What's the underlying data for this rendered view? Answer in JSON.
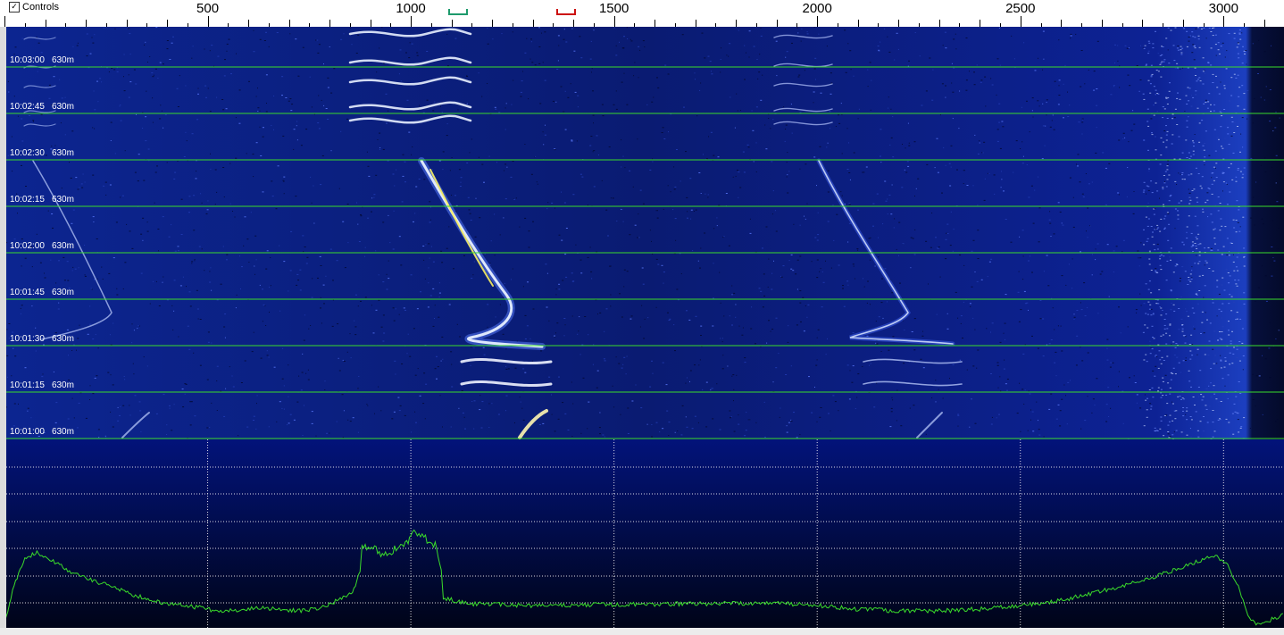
{
  "controls": {
    "label": "Controls",
    "checked": true
  },
  "frequency_axis": {
    "min_hz": 0,
    "max_hz": 3150,
    "labels": [
      "500",
      "1000",
      "1500",
      "2000",
      "2500",
      "3000"
    ],
    "label_values": [
      500,
      1000,
      1500,
      2000,
      2500,
      3000
    ]
  },
  "markers": [
    {
      "name": "rx-marker",
      "freq": 1115,
      "color": "#1d9a6c"
    },
    {
      "name": "tx-marker",
      "freq": 1380,
      "color": "#cc1111"
    }
  ],
  "waterfall": {
    "band": "630m",
    "timestamps": [
      "10:03:00",
      "10:02:45",
      "10:02:30",
      "10:02:15",
      "10:02:00",
      "10:01:45",
      "10:01:30",
      "10:01:15",
      "10:01:00"
    ],
    "separator_color": "#3adb2a",
    "background_color": "#0a1a6a"
  },
  "spectrum": {
    "trace_color": "#3adb2a",
    "grid_color": "#ffffff",
    "background_top": "#02137a",
    "background_bottom": "#000418",
    "trace": [
      [
        0,
        700
      ],
      [
        20,
        660
      ],
      [
        50,
        625
      ],
      [
        80,
        618
      ],
      [
        120,
        628
      ],
      [
        160,
        640
      ],
      [
        220,
        650
      ],
      [
        280,
        660
      ],
      [
        330,
        668
      ],
      [
        400,
        676
      ],
      [
        480,
        680
      ],
      [
        520,
        684
      ],
      [
        560,
        684
      ],
      [
        620,
        680
      ],
      [
        680,
        682
      ],
      [
        730,
        684
      ],
      [
        780,
        680
      ],
      [
        830,
        670
      ],
      [
        860,
        660
      ],
      [
        875,
        640
      ],
      [
        880,
        610
      ],
      [
        930,
        620
      ],
      [
        960,
        615
      ],
      [
        990,
        610
      ],
      [
        1000,
        600
      ],
      [
        1020,
        595
      ],
      [
        1040,
        605
      ],
      [
        1060,
        610
      ],
      [
        1075,
        640
      ],
      [
        1080,
        670
      ],
      [
        1150,
        676
      ],
      [
        1300,
        678
      ],
      [
        1500,
        677
      ],
      [
        1700,
        676
      ],
      [
        1900,
        675
      ],
      [
        2000,
        678
      ],
      [
        2100,
        682
      ],
      [
        2200,
        684
      ],
      [
        2300,
        684
      ],
      [
        2400,
        682
      ],
      [
        2500,
        678
      ],
      [
        2600,
        672
      ],
      [
        2700,
        662
      ],
      [
        2800,
        650
      ],
      [
        2880,
        638
      ],
      [
        2940,
        628
      ],
      [
        2980,
        622
      ],
      [
        3010,
        632
      ],
      [
        3040,
        660
      ],
      [
        3060,
        690
      ],
      [
        3080,
        700
      ],
      [
        3150,
        688
      ]
    ]
  }
}
